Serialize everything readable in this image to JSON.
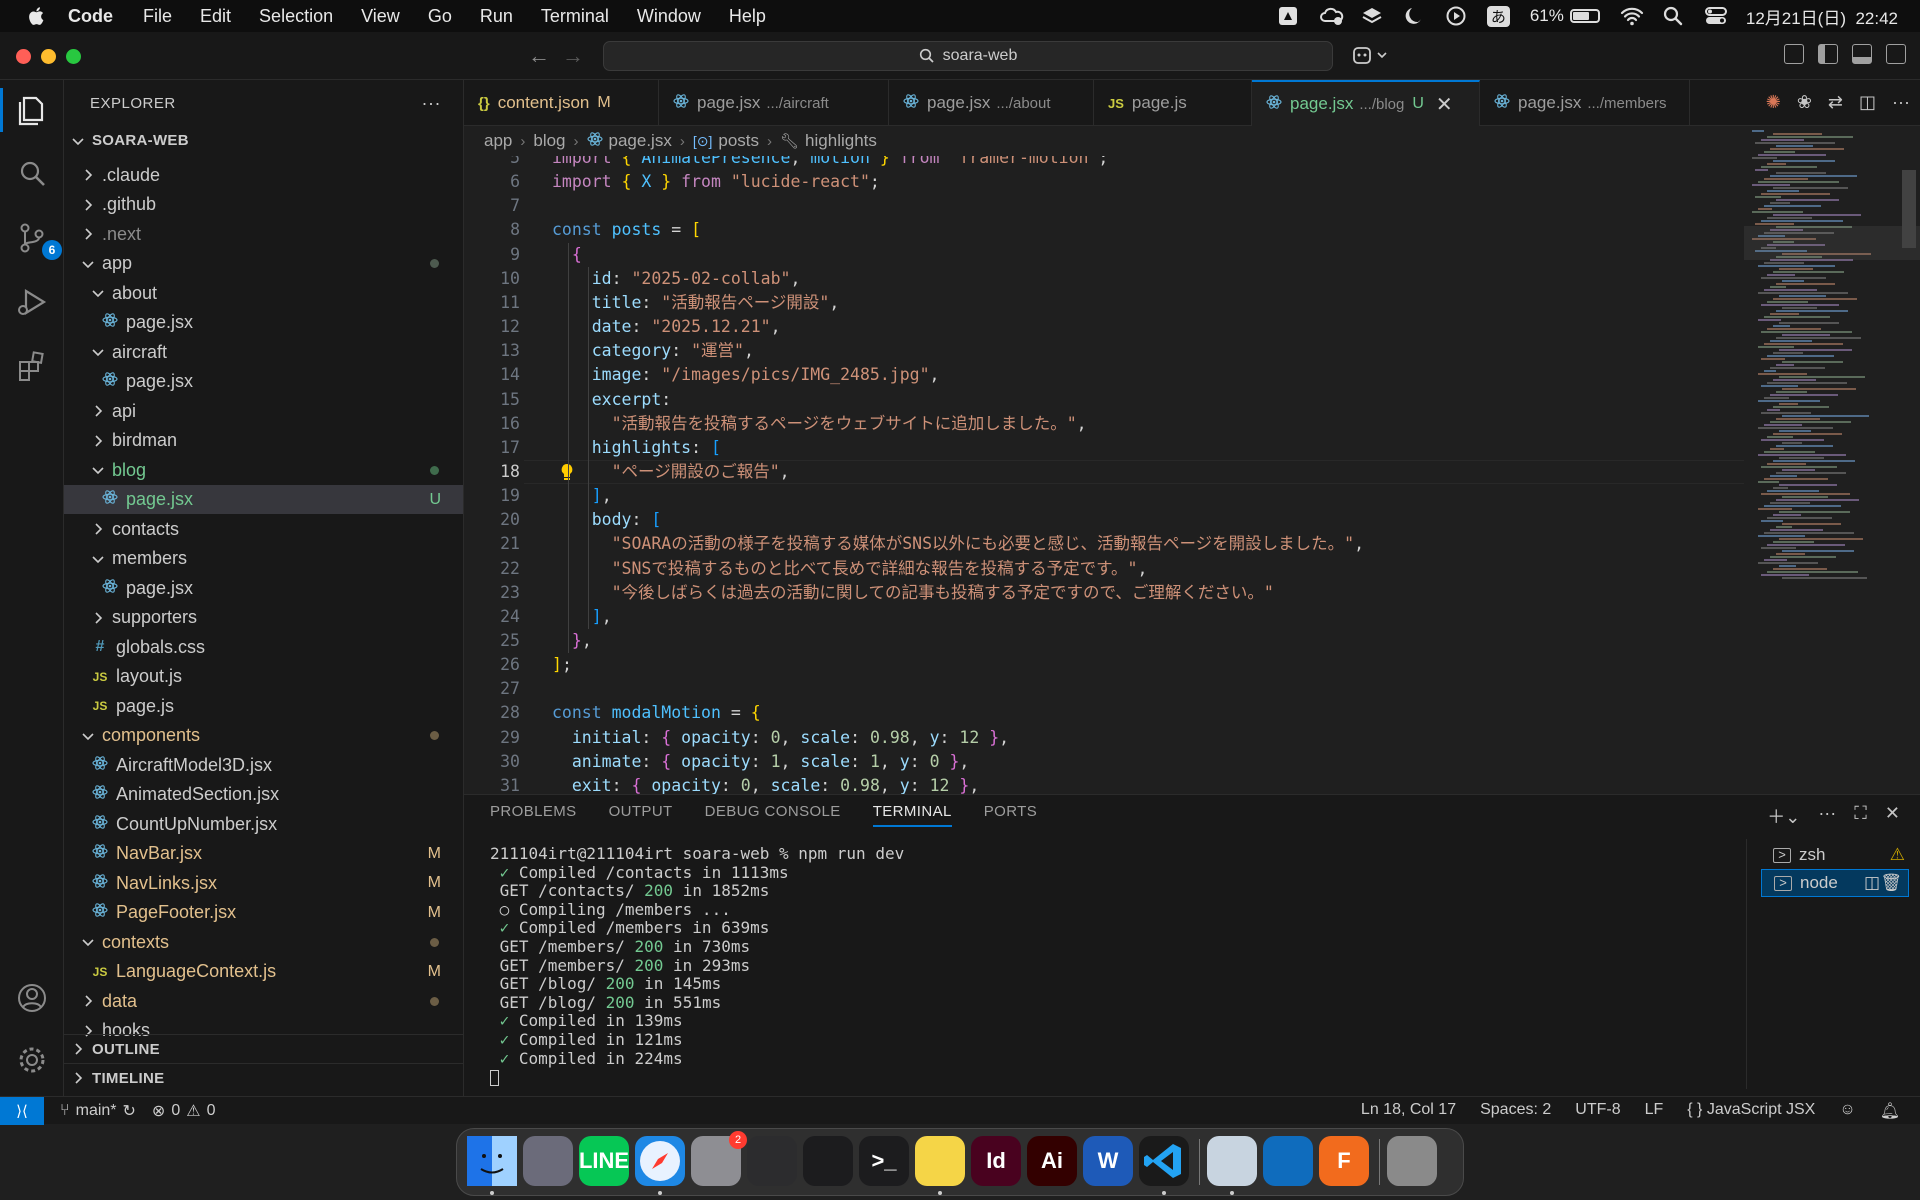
{
  "menubar": {
    "app": "Code",
    "items": [
      "File",
      "Edit",
      "Selection",
      "View",
      "Go",
      "Run",
      "Terminal",
      "Window",
      "Help"
    ],
    "ime": "あ",
    "battery": "61%",
    "battery_level": 0.61,
    "datetime": "12月21日(日)  22:42"
  },
  "titlebar": {
    "search": "soara-web"
  },
  "activity": {
    "scm_badge": "6"
  },
  "explorer": {
    "title": "EXPLORER",
    "more": "···",
    "root": "SOARA-WEB",
    "items": [
      {
        "label": ".claude",
        "depth": 1,
        "type": "folder",
        "open": false
      },
      {
        "label": ".github",
        "depth": 1,
        "type": "folder",
        "open": false
      },
      {
        "label": ".next",
        "depth": 1,
        "type": "folder",
        "open": false,
        "dim": true
      },
      {
        "label": "app",
        "depth": 1,
        "type": "folder",
        "open": true,
        "dot": true
      },
      {
        "label": "about",
        "depth": 2,
        "type": "folder",
        "open": true
      },
      {
        "label": "page.jsx",
        "depth": 3,
        "type": "react"
      },
      {
        "label": "aircraft",
        "depth": 2,
        "type": "folder",
        "open": true
      },
      {
        "label": "page.jsx",
        "depth": 3,
        "type": "react"
      },
      {
        "label": "api",
        "depth": 2,
        "type": "folder",
        "open": false
      },
      {
        "label": "birdman",
        "depth": 2,
        "type": "folder",
        "open": false
      },
      {
        "label": "blog",
        "depth": 2,
        "type": "folder",
        "open": true,
        "dot": true,
        "color": "green"
      },
      {
        "label": "page.jsx",
        "depth": 3,
        "type": "react",
        "badge": "U",
        "selected": true,
        "color": "green"
      },
      {
        "label": "contacts",
        "depth": 2,
        "type": "folder",
        "open": false
      },
      {
        "label": "members",
        "depth": 2,
        "type": "folder",
        "open": true
      },
      {
        "label": "page.jsx",
        "depth": 3,
        "type": "react"
      },
      {
        "label": "supporters",
        "depth": 2,
        "type": "folder",
        "open": false
      },
      {
        "label": "globals.css",
        "depth": 2,
        "type": "css"
      },
      {
        "label": "layout.js",
        "depth": 2,
        "type": "js"
      },
      {
        "label": "page.js",
        "depth": 2,
        "type": "js"
      },
      {
        "label": "components",
        "depth": 1,
        "type": "folder",
        "open": true,
        "dot": true,
        "color": "mod"
      },
      {
        "label": "AircraftModel3D.jsx",
        "depth": 2,
        "type": "react"
      },
      {
        "label": "AnimatedSection.jsx",
        "depth": 2,
        "type": "react"
      },
      {
        "label": "CountUpNumber.jsx",
        "depth": 2,
        "type": "react"
      },
      {
        "label": "NavBar.jsx",
        "depth": 2,
        "type": "react",
        "badge": "M",
        "color": "mod"
      },
      {
        "label": "NavLinks.jsx",
        "depth": 2,
        "type": "react",
        "badge": "M",
        "color": "mod"
      },
      {
        "label": "PageFooter.jsx",
        "depth": 2,
        "type": "react",
        "badge": "M",
        "color": "mod"
      },
      {
        "label": "contexts",
        "depth": 1,
        "type": "folder",
        "open": true,
        "dot": true,
        "color": "mod"
      },
      {
        "label": "LanguageContext.js",
        "depth": 2,
        "type": "js",
        "badge": "M",
        "color": "mod"
      },
      {
        "label": "data",
        "depth": 1,
        "type": "folder",
        "open": false,
        "dot": true,
        "color": "mod"
      },
      {
        "label": "hooks",
        "depth": 1,
        "type": "folder",
        "open": false
      }
    ],
    "outline": "OUTLINE",
    "timeline": "TIMELINE"
  },
  "tabs": [
    {
      "icon": "{}",
      "label": "content.json",
      "sub": "",
      "badge": "M"
    },
    {
      "icon": "react",
      "label": "page.jsx",
      "sub": ".../aircraft"
    },
    {
      "icon": "react",
      "label": "page.jsx",
      "sub": ".../about"
    },
    {
      "icon": "JS",
      "label": "page.js",
      "sub": ""
    },
    {
      "icon": "react",
      "label": "page.jsx",
      "sub": ".../blog",
      "badge": "U",
      "active": true
    },
    {
      "icon": "react",
      "label": "page.jsx",
      "sub": ".../members"
    }
  ],
  "breadcrumb": [
    "app",
    "blog",
    "page.jsx",
    "posts",
    "highlights"
  ],
  "code": [
    {
      "n": 5,
      "t": [
        [
          "t-kw2",
          "import "
        ],
        [
          "t-p1",
          "{ "
        ],
        [
          "t-var",
          "AnimatePresence"
        ],
        [
          "t-def",
          ", "
        ],
        [
          "t-var",
          "motion"
        ],
        [
          "t-p1",
          " } "
        ],
        [
          "t-kw2",
          "from "
        ],
        [
          "t-str",
          "\"framer-motion\""
        ],
        [
          "t-def",
          ";"
        ]
      ]
    },
    {
      "n": 6,
      "t": [
        [
          "t-kw2",
          "import "
        ],
        [
          "t-p1",
          "{ "
        ],
        [
          "t-var",
          "X"
        ],
        [
          "t-p1",
          " } "
        ],
        [
          "t-kw2",
          "from "
        ],
        [
          "t-str",
          "\"lucide-react\""
        ],
        [
          "t-def",
          ";"
        ]
      ]
    },
    {
      "n": 7,
      "t": []
    },
    {
      "n": 8,
      "t": [
        [
          "t-kw",
          "const "
        ],
        [
          "t-var",
          "posts"
        ],
        [
          "t-def",
          " = "
        ],
        [
          "t-p1",
          "["
        ]
      ]
    },
    {
      "n": 9,
      "t": [
        [
          "t-def",
          "  "
        ],
        [
          "t-p2",
          "{"
        ]
      ]
    },
    {
      "n": 10,
      "t": [
        [
          "t-def",
          "    "
        ],
        [
          "t-prop",
          "id"
        ],
        [
          "t-def",
          ": "
        ],
        [
          "t-str",
          "\"2025-02-collab\""
        ],
        [
          "t-def",
          ","
        ]
      ]
    },
    {
      "n": 11,
      "t": [
        [
          "t-def",
          "    "
        ],
        [
          "t-prop",
          "title"
        ],
        [
          "t-def",
          ": "
        ],
        [
          "t-str",
          "\"活動報告ページ開設\""
        ],
        [
          "t-def",
          ","
        ]
      ]
    },
    {
      "n": 12,
      "t": [
        [
          "t-def",
          "    "
        ],
        [
          "t-prop",
          "date"
        ],
        [
          "t-def",
          ": "
        ],
        [
          "t-str",
          "\"2025.12.21\""
        ],
        [
          "t-def",
          ","
        ]
      ]
    },
    {
      "n": 13,
      "t": [
        [
          "t-def",
          "    "
        ],
        [
          "t-prop",
          "category"
        ],
        [
          "t-def",
          ": "
        ],
        [
          "t-str",
          "\"運営\""
        ],
        [
          "t-def",
          ","
        ]
      ]
    },
    {
      "n": 14,
      "t": [
        [
          "t-def",
          "    "
        ],
        [
          "t-prop",
          "image"
        ],
        [
          "t-def",
          ": "
        ],
        [
          "t-str",
          "\"/images/pics/IMG_2485.jpg\""
        ],
        [
          "t-def",
          ","
        ]
      ]
    },
    {
      "n": 15,
      "t": [
        [
          "t-def",
          "    "
        ],
        [
          "t-prop",
          "excerpt"
        ],
        [
          "t-def",
          ":"
        ]
      ]
    },
    {
      "n": 16,
      "t": [
        [
          "t-def",
          "      "
        ],
        [
          "t-str",
          "\"活動報告を投稿するページをウェブサイトに追加しました。\""
        ],
        [
          "t-def",
          ","
        ]
      ]
    },
    {
      "n": 17,
      "t": [
        [
          "t-def",
          "    "
        ],
        [
          "t-prop",
          "highlights"
        ],
        [
          "t-def",
          ": "
        ],
        [
          "t-p3",
          "["
        ]
      ]
    },
    {
      "n": 18,
      "t": [
        [
          "t-def",
          "      "
        ],
        [
          "t-str",
          "\"ページ開設のご報告\""
        ],
        [
          "t-def",
          ","
        ]
      ],
      "cur": true
    },
    {
      "n": 19,
      "t": [
        [
          "t-def",
          "    "
        ],
        [
          "t-p3",
          "]"
        ],
        [
          "t-def",
          ","
        ]
      ]
    },
    {
      "n": 20,
      "t": [
        [
          "t-def",
          "    "
        ],
        [
          "t-prop",
          "body"
        ],
        [
          "t-def",
          ": "
        ],
        [
          "t-p3",
          "["
        ]
      ]
    },
    {
      "n": 21,
      "t": [
        [
          "t-def",
          "      "
        ],
        [
          "t-str",
          "\"SOARAの活動の様子を投稿する媒体がSNS以外にも必要と感じ、活動報告ページを開設しました。\""
        ],
        [
          "t-def",
          ","
        ]
      ]
    },
    {
      "n": 22,
      "t": [
        [
          "t-def",
          "      "
        ],
        [
          "t-str",
          "\"SNSで投稿するものと比べて長めで詳細な報告を投稿する予定です。\""
        ],
        [
          "t-def",
          ","
        ]
      ]
    },
    {
      "n": 23,
      "t": [
        [
          "t-def",
          "      "
        ],
        [
          "t-str",
          "\"今後しばらくは過去の活動に関しての記事も投稿する予定ですので、ご理解ください。\""
        ]
      ]
    },
    {
      "n": 24,
      "t": [
        [
          "t-def",
          "    "
        ],
        [
          "t-p3",
          "]"
        ],
        [
          "t-def",
          ","
        ]
      ]
    },
    {
      "n": 25,
      "t": [
        [
          "t-def",
          "  "
        ],
        [
          "t-p2",
          "}"
        ],
        [
          "t-def",
          ","
        ]
      ]
    },
    {
      "n": 26,
      "t": [
        [
          "t-p1",
          "]"
        ],
        [
          "t-def",
          ";"
        ]
      ]
    },
    {
      "n": 27,
      "t": []
    },
    {
      "n": 28,
      "t": [
        [
          "t-kw",
          "const "
        ],
        [
          "t-var",
          "modalMotion"
        ],
        [
          "t-def",
          " = "
        ],
        [
          "t-p1",
          "{"
        ]
      ]
    },
    {
      "n": 29,
      "t": [
        [
          "t-def",
          "  "
        ],
        [
          "t-prop",
          "initial"
        ],
        [
          "t-def",
          ": "
        ],
        [
          "t-p2",
          "{ "
        ],
        [
          "t-prop",
          "opacity"
        ],
        [
          "t-def",
          ": "
        ],
        [
          "t-num",
          "0"
        ],
        [
          "t-def",
          ", "
        ],
        [
          "t-prop",
          "scale"
        ],
        [
          "t-def",
          ": "
        ],
        [
          "t-num",
          "0.98"
        ],
        [
          "t-def",
          ", "
        ],
        [
          "t-prop",
          "y"
        ],
        [
          "t-def",
          ": "
        ],
        [
          "t-num",
          "12"
        ],
        [
          "t-p2",
          " }"
        ],
        [
          "t-def",
          ","
        ]
      ]
    },
    {
      "n": 30,
      "t": [
        [
          "t-def",
          "  "
        ],
        [
          "t-prop",
          "animate"
        ],
        [
          "t-def",
          ": "
        ],
        [
          "t-p2",
          "{ "
        ],
        [
          "t-prop",
          "opacity"
        ],
        [
          "t-def",
          ": "
        ],
        [
          "t-num",
          "1"
        ],
        [
          "t-def",
          ", "
        ],
        [
          "t-prop",
          "scale"
        ],
        [
          "t-def",
          ": "
        ],
        [
          "t-num",
          "1"
        ],
        [
          "t-def",
          ", "
        ],
        [
          "t-prop",
          "y"
        ],
        [
          "t-def",
          ": "
        ],
        [
          "t-num",
          "0"
        ],
        [
          "t-p2",
          " }"
        ],
        [
          "t-def",
          ","
        ]
      ]
    },
    {
      "n": 31,
      "t": [
        [
          "t-def",
          "  "
        ],
        [
          "t-prop",
          "exit"
        ],
        [
          "t-def",
          ": "
        ],
        [
          "t-p2",
          "{ "
        ],
        [
          "t-prop",
          "opacity"
        ],
        [
          "t-def",
          ": "
        ],
        [
          "t-num",
          "0"
        ],
        [
          "t-def",
          ", "
        ],
        [
          "t-prop",
          "scale"
        ],
        [
          "t-def",
          ": "
        ],
        [
          "t-num",
          "0.98"
        ],
        [
          "t-def",
          ", "
        ],
        [
          "t-prop",
          "y"
        ],
        [
          "t-def",
          ": "
        ],
        [
          "t-num",
          "12"
        ],
        [
          "t-p2",
          " }"
        ],
        [
          "t-def",
          ","
        ]
      ]
    }
  ],
  "panel": {
    "tabs": [
      "PROBLEMS",
      "OUTPUT",
      "DEBUG CONSOLE",
      "TERMINAL",
      "PORTS"
    ],
    "active_tab": "TERMINAL",
    "terminal_lines": [
      {
        "kind": "prompt",
        "text": "211104irt@211104irt soara-web % npm run dev"
      },
      {
        "kind": "ok",
        "text": "Compiled /contacts in 1113ms"
      },
      {
        "kind": "get",
        "path": "GET /contacts/",
        "code": "200",
        "rest": "in 1852ms"
      },
      {
        "kind": "wait",
        "text": "Compiling /members ..."
      },
      {
        "kind": "ok",
        "text": "Compiled /members in 639ms"
      },
      {
        "kind": "get",
        "path": "GET /members/",
        "code": "200",
        "rest": "in 730ms"
      },
      {
        "kind": "get",
        "path": "GET /members/",
        "code": "200",
        "rest": "in 293ms"
      },
      {
        "kind": "get",
        "path": "GET /blog/",
        "code": "200",
        "rest": "in 145ms"
      },
      {
        "kind": "get",
        "path": "GET /blog/",
        "code": "200",
        "rest": "in 551ms"
      },
      {
        "kind": "ok",
        "text": "Compiled in 139ms"
      },
      {
        "kind": "ok",
        "text": "Compiled in 121ms"
      },
      {
        "kind": "ok",
        "text": "Compiled in 224ms"
      }
    ],
    "terminals": [
      {
        "label": "zsh",
        "warn": true
      },
      {
        "label": "node",
        "active": true
      }
    ]
  },
  "statusbar": {
    "branch": "main*",
    "errors": "0",
    "warnings": "0",
    "position": "Ln 18, Col 17",
    "spaces": "Spaces: 2",
    "encoding": "UTF-8",
    "eol": "LF",
    "language": "JavaScript JSX"
  },
  "dock": {
    "apps": [
      {
        "name": "finder",
        "color": "#3d8ef0",
        "label": "",
        "dot": true
      },
      {
        "name": "launchpad",
        "color": "#6b6b7a",
        "label": ""
      },
      {
        "name": "line",
        "color": "#06c755",
        "label": "LINE"
      },
      {
        "name": "safari",
        "color": "#1e88e5",
        "label": "",
        "dot": true
      },
      {
        "name": "system-settings",
        "color": "#8e8e93",
        "label": "",
        "badge": "2"
      },
      {
        "name": "mission-control",
        "color": "#2c2c2e",
        "label": ""
      },
      {
        "name": "activity-monitor",
        "color": "#1c1c1e",
        "label": ""
      },
      {
        "name": "terminal",
        "color": "#1c1c1e",
        "label": ">_"
      },
      {
        "name": "notes",
        "color": "#f5d547",
        "label": "",
        "dot": true
      },
      {
        "name": "indesign",
        "color": "#49021f",
        "label": "Id"
      },
      {
        "name": "illustrator",
        "color": "#330000",
        "label": "Ai"
      },
      {
        "name": "word",
        "color": "#1e5ab8",
        "label": "W"
      },
      {
        "name": "vscode",
        "color": "#1a1a1a",
        "label": "",
        "dot": true
      },
      {
        "name": "preview",
        "color": "#c8d4e0",
        "label": "",
        "dot": true
      },
      {
        "name": "onedrive",
        "color": "#0f6cbd",
        "label": ""
      },
      {
        "name": "fusion",
        "color": "#f26b1d",
        "label": "F"
      },
      {
        "name": "trash",
        "color": "#8a8a8a",
        "label": ""
      }
    ]
  }
}
